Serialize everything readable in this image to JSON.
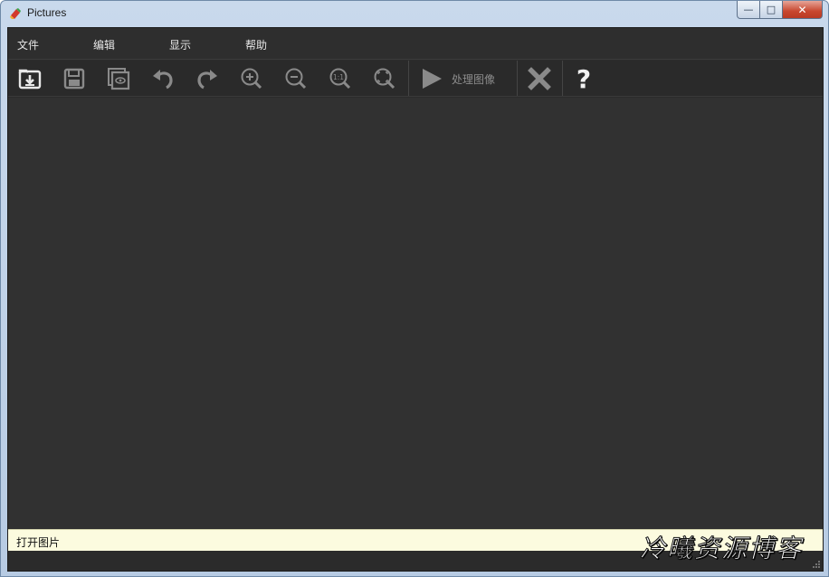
{
  "window": {
    "title": "Pictures",
    "controls": {
      "minimize": "—",
      "maximize": "□",
      "close": "✕"
    }
  },
  "menu": {
    "items": [
      {
        "label": "文件"
      },
      {
        "label": "编辑"
      },
      {
        "label": "显示"
      },
      {
        "label": "帮助"
      }
    ]
  },
  "toolbar": {
    "buttons": [
      {
        "name": "open-icon"
      },
      {
        "name": "save-icon"
      },
      {
        "name": "preview-icon"
      },
      {
        "name": "undo-icon"
      },
      {
        "name": "redo-icon"
      },
      {
        "name": "zoom-in-icon"
      },
      {
        "name": "zoom-out-icon"
      },
      {
        "name": "zoom-actual-icon",
        "text": "1:1"
      },
      {
        "name": "zoom-fit-icon"
      }
    ],
    "process_label": "处理图像",
    "cancel_icon": "close-icon",
    "help_label": "?"
  },
  "status": {
    "text": "打开图片"
  },
  "watermark": {
    "text": "冷曦资源博客"
  },
  "colors": {
    "client_bg": "#2b2b2b",
    "canvas_bg": "#313131",
    "status_bg": "#fcfbdf",
    "icon_light": "#e8e8e8",
    "icon_dim": "#8a8a8a"
  }
}
